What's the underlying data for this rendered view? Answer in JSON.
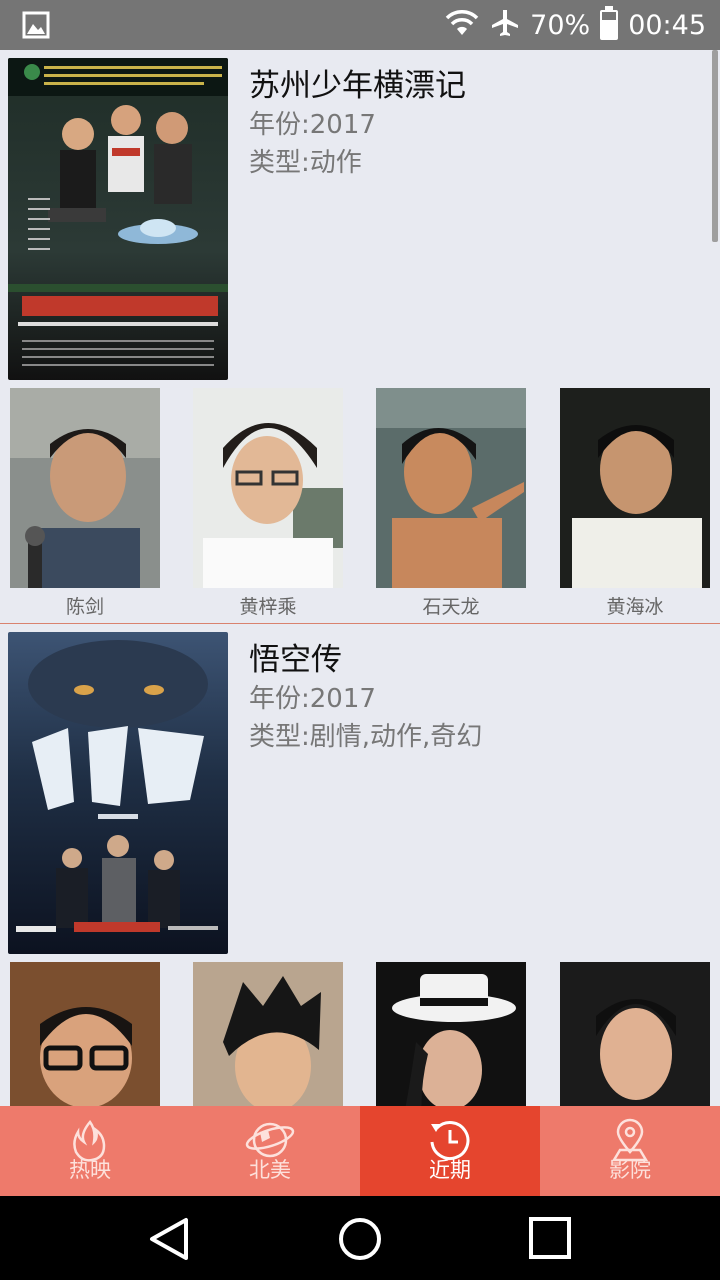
{
  "status_bar": {
    "battery_percent": "70%",
    "battery_level": 0.7,
    "time": "00:45",
    "icons": [
      "gallery-icon",
      "wifi-icon",
      "airplane-mode-icon",
      "battery-icon"
    ]
  },
  "movies": [
    {
      "title": "苏州少年横漂记",
      "year": "年份:2017",
      "genre": "类型:动作",
      "cast": [
        {
          "name": "陈剑"
        },
        {
          "name": "黄梓乘"
        },
        {
          "name": "石天龙"
        },
        {
          "name": "黄海冰"
        }
      ]
    },
    {
      "title": "悟空传",
      "year": "年份:2017",
      "genre": "类型:剧情,动作,奇幻",
      "cast": [
        {
          "name": ""
        },
        {
          "name": ""
        },
        {
          "name": ""
        },
        {
          "name": ""
        }
      ]
    }
  ],
  "tabs": [
    {
      "label": "热映",
      "icon": "flame-icon",
      "active": false
    },
    {
      "label": "北美",
      "icon": "globe-icon",
      "active": false
    },
    {
      "label": "近期",
      "icon": "clock-refresh-icon",
      "active": true
    },
    {
      "label": "影院",
      "icon": "location-pin-icon",
      "active": false
    }
  ],
  "colors": {
    "tab_bar": "#ee7a6b",
    "tab_active": "#e5452e",
    "list_background": "#e8eaf1",
    "divider": "#d9826e"
  },
  "nav": {
    "buttons": [
      "back-icon",
      "home-icon",
      "recents-icon"
    ]
  }
}
